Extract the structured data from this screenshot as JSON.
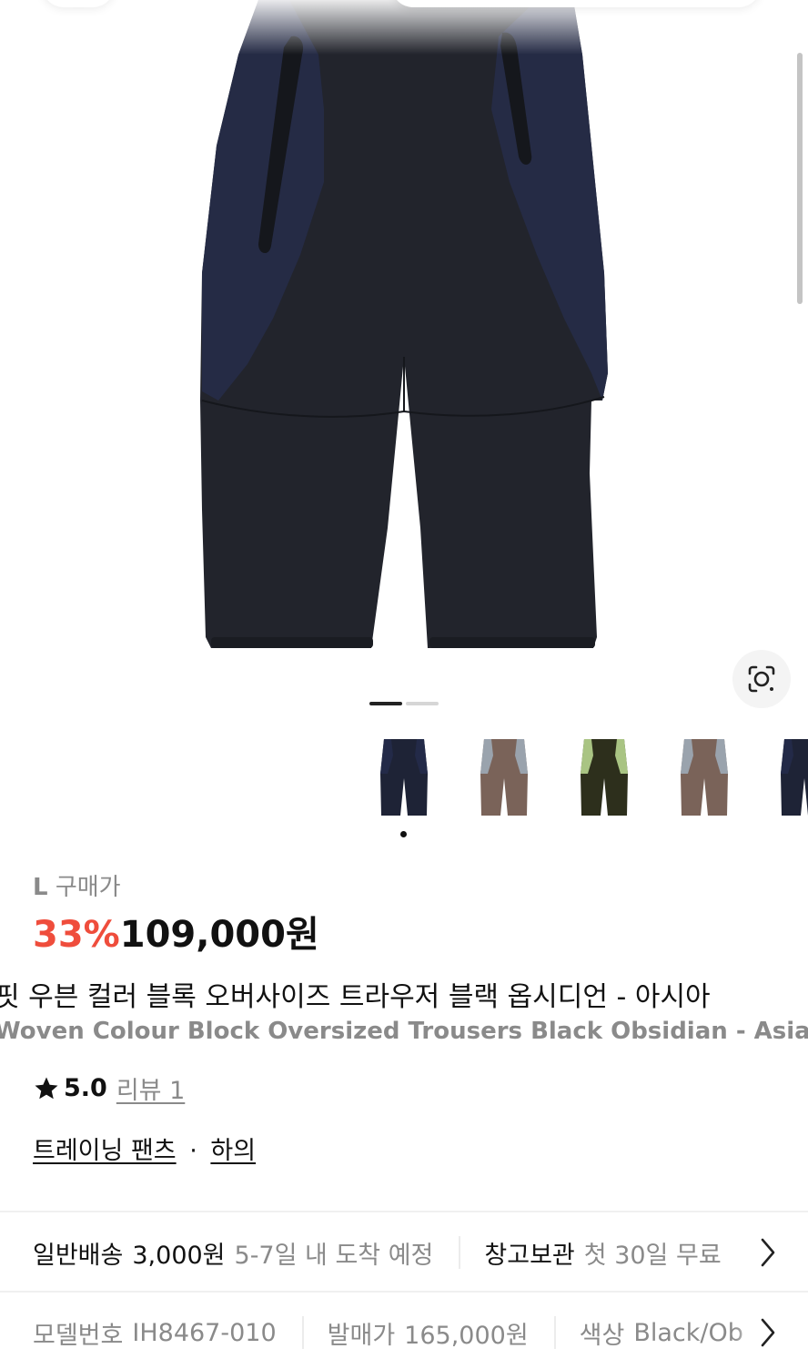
{
  "gallery": {
    "image_alt": "black obsidian woven colour block trousers",
    "page_indicator": {
      "current": 1,
      "total": 2
    },
    "thumbnails": [
      {
        "name": "black-navy",
        "color": "#1e2336",
        "accent": "#232a48"
      },
      {
        "name": "brown-grey",
        "color": "#7a6359",
        "accent": "#9aa3ad"
      },
      {
        "name": "olive-green",
        "color": "#2d2f1c",
        "accent": "#a9c483"
      },
      {
        "name": "brown-grey-2",
        "color": "#7a6359",
        "accent": "#9aa3ad"
      },
      {
        "name": "black-navy-2",
        "color": "#1e2336",
        "accent": "#232a48"
      }
    ]
  },
  "price": {
    "size_label": "L",
    "buy_label": "구매가",
    "discount": "33%",
    "amount": "109,000원"
  },
  "product": {
    "title_ko": "핏 우븐 컬러 블록 오버사이즈 트라우저 블랙 옵시디언 - 아시아",
    "title_en": "Woven Colour Block Oversized Trousers Black Obsidian - Asia",
    "rating": "5.0",
    "review_label": "리뷰 1",
    "category_1": "트레이닝 팬츠",
    "category_sep": "·",
    "category_2": "하의"
  },
  "shipping": {
    "type_label": "일반배송",
    "fee": "3,000원",
    "eta": "5-7일 내 도착 예정",
    "storage_label": "창고보관",
    "storage_value": "첫 30일 무료"
  },
  "specs": {
    "model_label": "모델번호",
    "model_value": "IH8467-010",
    "release_label": "발매가",
    "release_value": "165,000원",
    "color_label": "색상",
    "color_value": "Black/Ob"
  },
  "colors": {
    "discount_red": "#ef4d3c",
    "muted_grey": "#8a8a8a",
    "body_text": "#111111"
  }
}
